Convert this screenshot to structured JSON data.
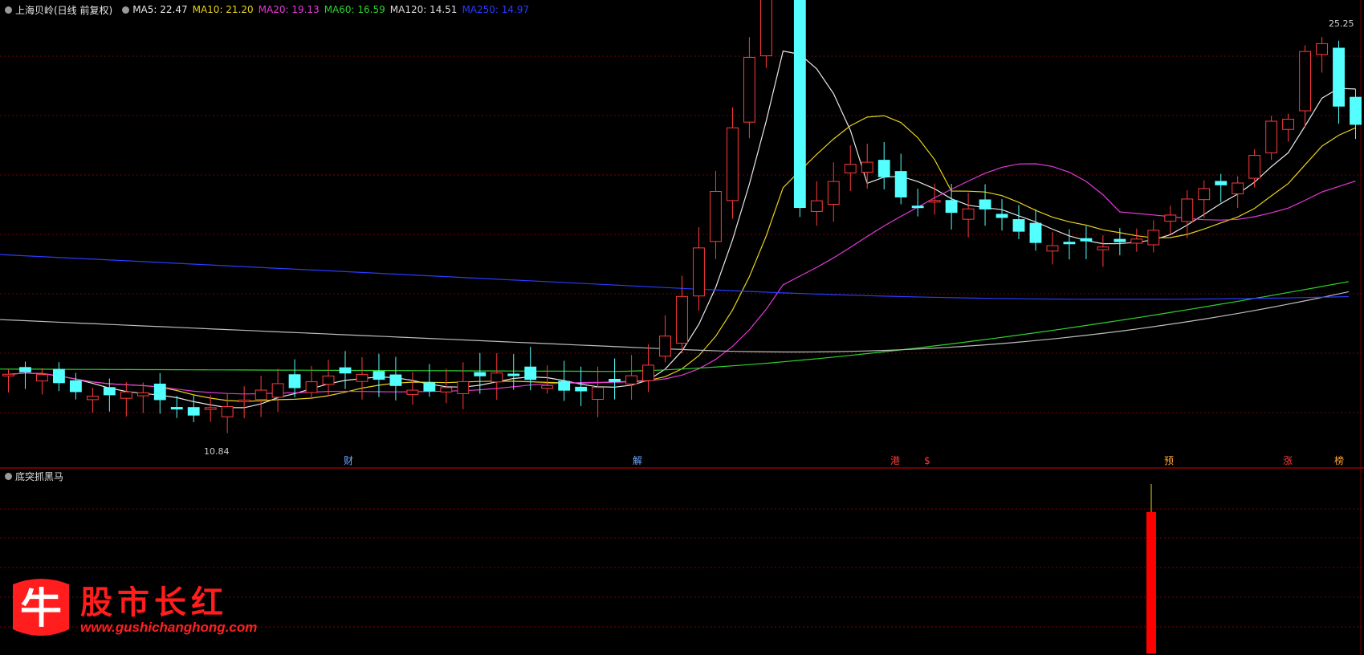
{
  "header": {
    "stock_title": "上海贝岭(日线 前复权)",
    "ma": [
      {
        "label": "MA5: 22.47",
        "color": "#e8e8e8"
      },
      {
        "label": "MA10: 21.20",
        "color": "#e8d21b"
      },
      {
        "label": "MA20: 19.13",
        "color": "#e43ad8"
      },
      {
        "label": "MA60: 16.59",
        "color": "#2ed12e"
      },
      {
        "label": "MA120: 14.51",
        "color": "#d8d8d8"
      },
      {
        "label": "MA250: 14.97",
        "color": "#2a3cff"
      }
    ]
  },
  "indicator": {
    "name": "底突抓黑马"
  },
  "price_labels": {
    "high": "25.25",
    "low": "10.84"
  },
  "event_markers": [
    {
      "text": "财",
      "color": "#6fa8ff"
    },
    {
      "text": "解",
      "color": "#6fa8ff"
    },
    {
      "text": "港",
      "color": "#ff3b3b"
    },
    {
      "text": "$",
      "color": "#ff3b3b"
    },
    {
      "text": "预",
      "color": "#ffa53b"
    },
    {
      "text": "涨",
      "color": "#ff3b3b"
    },
    {
      "text": "榜",
      "color": "#ffa53b"
    }
  ],
  "watermark": {
    "logo_char": "牛",
    "title": "股市长红",
    "url": "www.gushichanghong.com"
  },
  "colors": {
    "up": "#ff3b3b",
    "down": "#54ffff",
    "grid": "#7a0000",
    "divider": "#b00000",
    "ma5": "#e8e8e8",
    "ma10": "#e8d21b",
    "ma20": "#e43ad8",
    "ma60": "#2ed12e",
    "ma120": "#bdbdbd",
    "ma250": "#2a3cff",
    "signal_bar": "#ff0000"
  }
}
